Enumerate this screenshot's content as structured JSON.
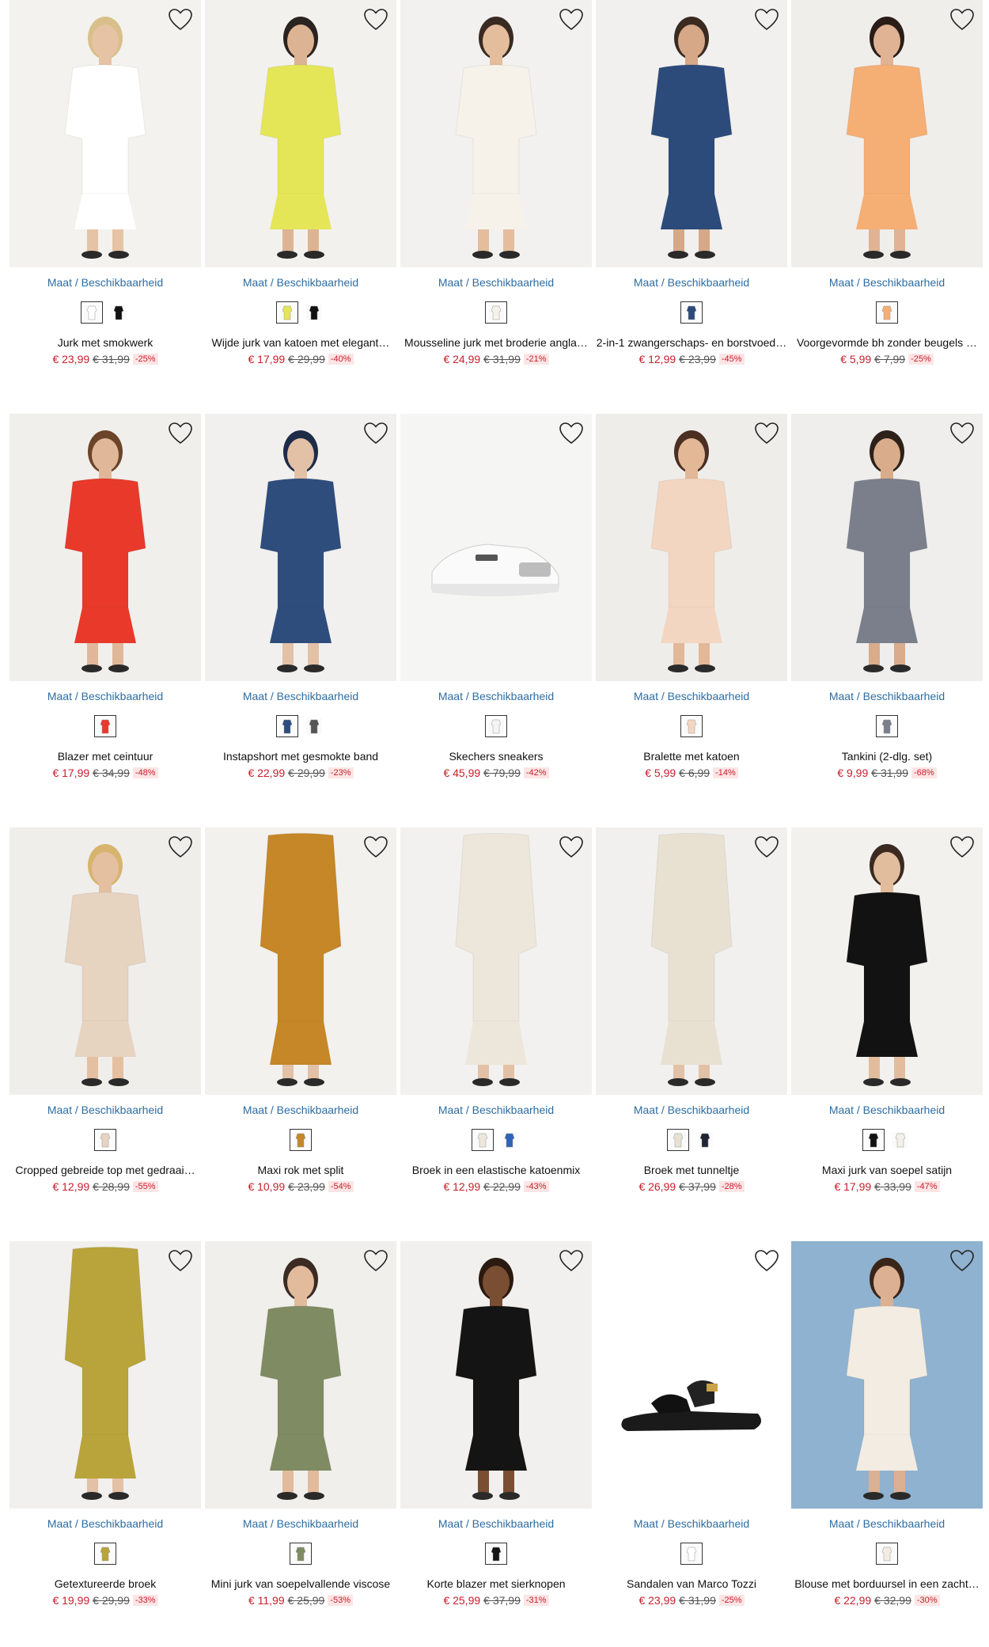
{
  "size_label": "Maat / Beschikbaarheid",
  "products": [
    {
      "title": "Jurk met smokwerk",
      "price": "€ 23,99",
      "old_price": "€ 31,99",
      "discount": "-25%",
      "bg": "#f3f2ee",
      "body": "#ffffff",
      "skin": "#e6c3a5",
      "hair": "#d9c08a",
      "swatches": [
        "#ffffff",
        "#111111"
      ]
    },
    {
      "title": "Wijde jurk van katoen met elegant…",
      "price": "€ 17,99",
      "old_price": "€ 29,99",
      "discount": "-40%",
      "bg": "#f2f1ee",
      "body": "#e5e657",
      "skin": "#ddb493",
      "hair": "#2b2320",
      "swatches": [
        "#e5e657",
        "#111111"
      ]
    },
    {
      "title": "Mousseline jurk met broderie angla…",
      "price": "€ 24,99",
      "old_price": "€ 31,99",
      "discount": "-21%",
      "bg": "#f2f1ef",
      "body": "#f6f2ea",
      "skin": "#e4bd9c",
      "hair": "#3a2b22",
      "swatches": [
        "#f6f2ea"
      ]
    },
    {
      "title": "2-in-1 zwangerschaps- en borstvoed…",
      "price": "€ 12,99",
      "old_price": "€ 23,99",
      "discount": "-45%",
      "bg": "#f1f0ee",
      "body": "#2d4b7a",
      "skin": "#d6a887",
      "hair": "#3a2a20",
      "swatches": [
        "#2d4b7a"
      ]
    },
    {
      "title": "Voorgevormde bh zonder beugels …",
      "price": "€ 5,99",
      "old_price": "€ 7,99",
      "discount": "-25%",
      "bg": "#f0eeeb",
      "body": "#f5ae74",
      "skin": "#e0b394",
      "hair": "#2a1d17",
      "swatches": [
        "#f5ae74"
      ]
    },
    {
      "title": "Blazer met ceintuur",
      "price": "€ 17,99",
      "old_price": "€ 34,99",
      "discount": "-48%",
      "bg": "#f1efec",
      "body": "#e8392b",
      "skin": "#e0b899",
      "hair": "#6b4429",
      "swatches": [
        "#e8392b"
      ]
    },
    {
      "title": "Instapshort met gesmokte band",
      "price": "€ 22,99",
      "old_price": "€ 29,99",
      "discount": "-23%",
      "bg": "#f1f0ee",
      "body": "#2e4d7d",
      "skin": "#e3c1a6",
      "hair": "#1e2c48",
      "swatches": [
        "#2e4d7d",
        "#555555"
      ]
    },
    {
      "title": "Skechers sneakers",
      "price": "€ 45,99",
      "old_price": "€ 79,99",
      "discount": "-42%",
      "bg": "#f5f5f4",
      "body": "#ffffff",
      "skin": "#f5f5f4",
      "hair": "#f5f5f4",
      "swatches": [
        "#f4f4f4"
      ]
    },
    {
      "title": "Bralette met katoen",
      "price": "€ 5,99",
      "old_price": "€ 6,99",
      "discount": "-14%",
      "bg": "#efedea",
      "body": "#f3d6c1",
      "skin": "#e2b897",
      "hair": "#4a2f22",
      "swatches": [
        "#f3d6c1"
      ]
    },
    {
      "title": "Tankini (2-dlg. set)",
      "price": "€ 9,99",
      "old_price": "€ 31,99",
      "discount": "-68%",
      "bg": "#efeeec",
      "body": "#7a7f8b",
      "skin": "#d9ac8b",
      "hair": "#2e2119",
      "swatches": [
        "#7a7f8b"
      ]
    },
    {
      "title": "Cropped gebreide top met gedraai…",
      "price": "€ 12,99",
      "old_price": "€ 28,99",
      "discount": "-55%",
      "bg": "#efeeeb",
      "body": "#e6d3c0",
      "skin": "#e4c0a0",
      "hair": "#d7b46e",
      "swatches": [
        "#e6d3c0"
      ]
    },
    {
      "title": "Maxi rok met split",
      "price": "€ 10,99",
      "old_price": "€ 23,99",
      "discount": "-54%",
      "bg": "#f2f1ee",
      "body": "#c58727",
      "skin": "#e3c1a6",
      "hair": "#f2f1ee",
      "swatches": [
        "#c58727"
      ]
    },
    {
      "title": "Broek in een elastische katoenmix",
      "price": "€ 12,99",
      "old_price": "€ 22,99",
      "discount": "-43%",
      "bg": "#f2f1ef",
      "body": "#ece7da",
      "skin": "#e3c1a6",
      "hair": "#f2f1ef",
      "swatches": [
        "#ece7da",
        "#2f63b5"
      ]
    },
    {
      "title": "Broek met tunneltje",
      "price": "€ 26,99",
      "old_price": "€ 37,99",
      "discount": "-28%",
      "bg": "#f1f0ee",
      "body": "#e8e1d2",
      "skin": "#e3c1a6",
      "hair": "#f1f0ee",
      "swatches": [
        "#e8e1d2",
        "#1e2433"
      ]
    },
    {
      "title": "Maxi jurk van soepel satijn",
      "price": "€ 17,99",
      "old_price": "€ 33,99",
      "discount": "-47%",
      "bg": "#f2f1ee",
      "body": "#121212",
      "skin": "#e2bd9d",
      "hair": "#3c2a20",
      "swatches": [
        "#121212",
        "#f3f0e8"
      ]
    },
    {
      "title": "Getextureerde broek",
      "price": "€ 19,99",
      "old_price": "€ 29,99",
      "discount": "-33%",
      "bg": "#f1f0ee",
      "body": "#b8a43a",
      "skin": "#e3c1a6",
      "hair": "#f1f0ee",
      "swatches": [
        "#b8a43a"
      ]
    },
    {
      "title": "Mini jurk van soepelvallende viscose",
      "price": "€ 11,99",
      "old_price": "€ 25,99",
      "discount": "-53%",
      "bg": "#f0efec",
      "body": "#7f8b62",
      "skin": "#e1bb9c",
      "hair": "#3b2b22",
      "swatches": [
        "#7f8b62"
      ]
    },
    {
      "title": "Korte blazer met sierknopen",
      "price": "€ 25,99",
      "old_price": "€ 37,99",
      "discount": "-31%",
      "bg": "#f1f0ee",
      "body": "#141414",
      "skin": "#7a4e32",
      "hair": "#2a1a10",
      "swatches": [
        "#141414"
      ]
    },
    {
      "title": "Sandalen van Marco Tozzi",
      "price": "€ 23,99",
      "old_price": "€ 31,99",
      "discount": "-25%",
      "bg": "#ffffff",
      "body": "#111111",
      "skin": "#ffffff",
      "hair": "#ffffff",
      "swatches": [
        "#ffffff"
      ]
    },
    {
      "title": "Blouse met borduursel in een zacht…",
      "price": "€ 22,99",
      "old_price": "€ 32,99",
      "discount": "-30%",
      "bg": "#8fb2d0",
      "body": "#f3ece2",
      "skin": "#dcb092",
      "hair": "#3a2519",
      "swatches": [
        "#f3ece2"
      ]
    }
  ]
}
